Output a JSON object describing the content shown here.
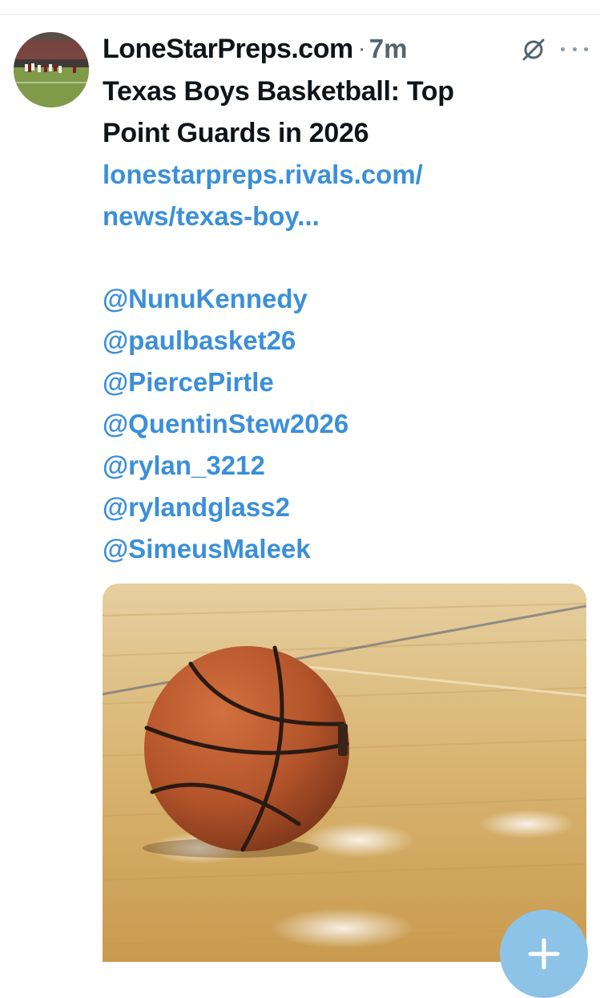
{
  "post": {
    "author_name": "LoneStarPreps.com",
    "separator": "·",
    "time_ago": "7m",
    "headline_line1": "Texas Boys Basketball: Top",
    "headline_line2": "Point Guards in 2026",
    "link_line1": "lonestarpreps.rivals.com/",
    "link_line2": "news/texas-boy...",
    "mentions": [
      "@NunuKennedy",
      "@paulbasket26",
      "@PiercePirtle",
      "@QuentinStew2026",
      "@rylan_3212",
      "@rylandglass2",
      "@SimeusMaleek"
    ]
  },
  "icons": {
    "avatar": "football-field-photo",
    "grok": "grok-slash-icon",
    "more": "more-dots-icon",
    "media": "basketball-on-court-photo",
    "compose": "plus-icon"
  },
  "colors": {
    "text": "#0f1419",
    "secondary": "#536471",
    "link": "#3b8fd9",
    "fab": "#8ec3e8"
  }
}
